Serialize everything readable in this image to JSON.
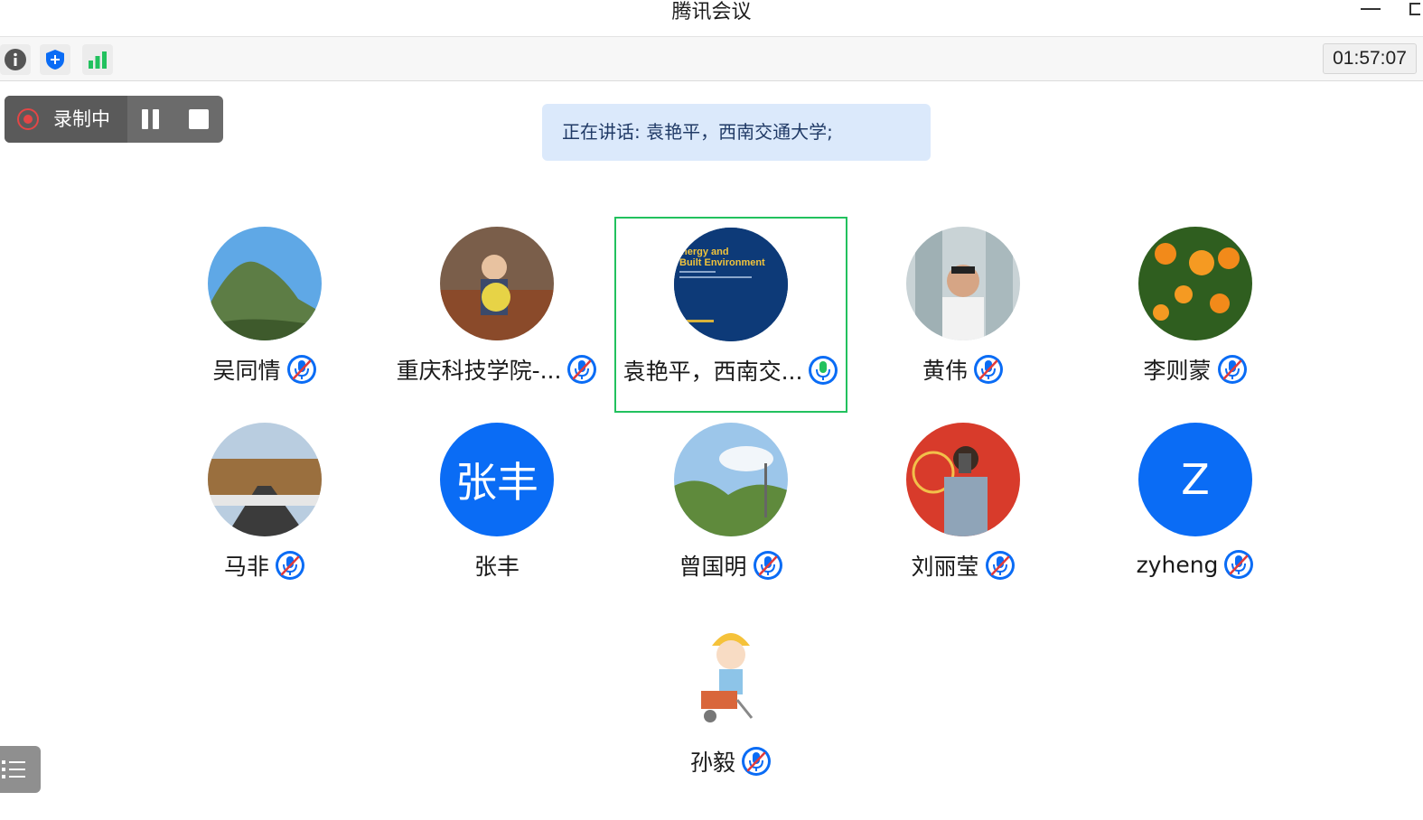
{
  "window": {
    "title": "腾讯会议"
  },
  "toolbar": {
    "timer": "01:57:07",
    "icons": [
      "info-icon",
      "security-shield-icon",
      "network-signal-icon"
    ]
  },
  "recording": {
    "label": "录制中"
  },
  "speaking": {
    "text": "正在讲话: 袁艳平，西南交通大学;"
  },
  "colors": {
    "accent": "#0a6cf5",
    "active_border": "#22c15e",
    "recording": "#e34646",
    "banner": "#dbe9fb"
  },
  "participants": [
    {
      "name": "吴同情",
      "mic": "muted"
    },
    {
      "name": "重庆科技学院-...",
      "mic": "muted"
    },
    {
      "name": "袁艳平，西南交...",
      "mic": "speaking",
      "active": true
    },
    {
      "name": "黄伟",
      "mic": "muted"
    },
    {
      "name": "李则蒙",
      "mic": "muted"
    },
    {
      "name": "马非",
      "mic": "muted"
    },
    {
      "name": "张丰",
      "mic": "none",
      "avatar_text": "张丰"
    },
    {
      "name": "曾国明",
      "mic": "muted"
    },
    {
      "name": "刘丽莹",
      "mic": "muted"
    },
    {
      "name": "zyheng",
      "mic": "muted",
      "avatar_text": "Z"
    },
    {
      "name": "孙毅",
      "mic": "muted"
    }
  ],
  "avatar_thumbnail": {
    "lines": [
      "nergy and",
      "Built Environment"
    ]
  }
}
